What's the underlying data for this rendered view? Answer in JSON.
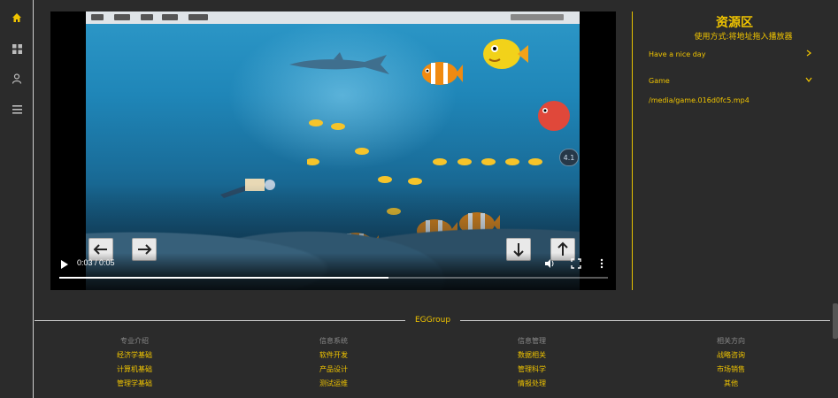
{
  "rail": {
    "icons": [
      "home-icon",
      "grid-icon",
      "user-icon",
      "menu-icon"
    ],
    "accent": "#f0c400"
  },
  "video": {
    "current_time": "0:03",
    "duration": "0:05",
    "time_label": "0:03 / 0:05",
    "progress_fraction": 0.6,
    "overlay_readout": "4.1"
  },
  "resources": {
    "title": "资源区",
    "subtitle": "使用方式:将地址拖入播放器",
    "items": [
      {
        "label": "Have a nice day",
        "chevron": "chevron-right-icon"
      },
      {
        "label": "Game",
        "chevron": "chevron-down-icon"
      }
    ],
    "file_path": "/media/game.016d0fc5.mp4"
  },
  "footer": {
    "brand": "EGGroup",
    "columns": [
      {
        "heading": "专业介绍",
        "links": [
          "经济学基础",
          "计算机基础",
          "管理学基础"
        ]
      },
      {
        "heading": "信息系统",
        "links": [
          "软件开发",
          "产品设计",
          "测试运维"
        ]
      },
      {
        "heading": "信息管理",
        "links": [
          "数据相关",
          "管理科学",
          "情报处理"
        ]
      },
      {
        "heading": "相关方向",
        "links": [
          "战略咨询",
          "市场销售",
          "其他"
        ]
      }
    ]
  }
}
